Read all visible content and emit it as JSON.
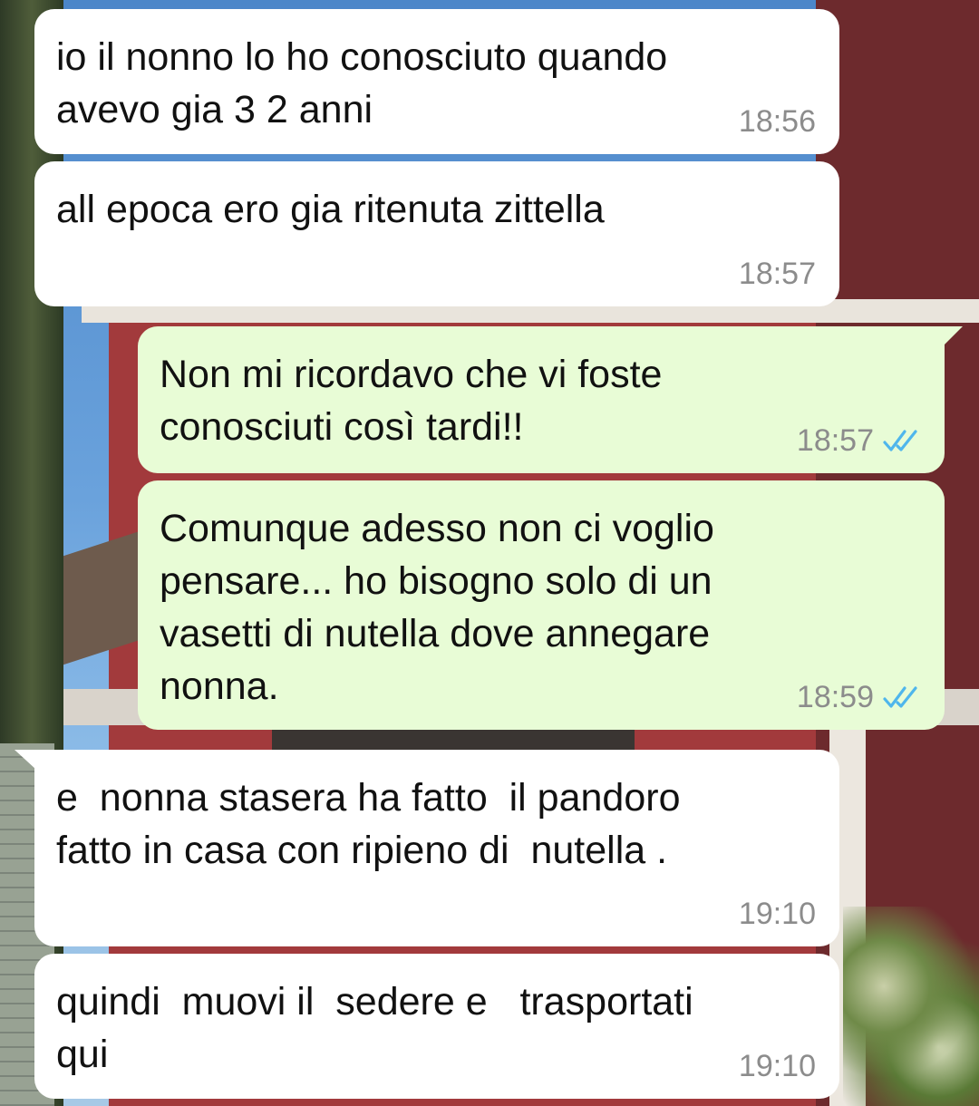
{
  "messages": [
    {
      "direction": "in",
      "text": "io il nonno lo ho conosciuto quando\navevo gia 3 2 anni",
      "time": "18:56"
    },
    {
      "direction": "in",
      "text": "all epoca ero gia ritenuta zittella",
      "time": "18:57"
    },
    {
      "direction": "out",
      "text": "Non mi ricordavo che vi foste\nconosciuti così tardi!!",
      "time": "18:57",
      "status": "read"
    },
    {
      "direction": "out",
      "text": "Comunque adesso non ci voglio\npensare... ho bisogno solo di un\nvasetti di nutella dove annegare\nnonna.",
      "time": "18:59",
      "status": "read"
    },
    {
      "direction": "in",
      "text": "e  nonna stasera ha fatto  il pandoro\nfatto in casa con ripieno di  nutella .",
      "time": "19:10"
    },
    {
      "direction": "in",
      "text": "quindi  muovi il  sedere e   trasportati\nqui",
      "time": "19:10"
    }
  ],
  "icons": {
    "read_receipt": "double-check-icon"
  },
  "colors": {
    "incoming_bubble": "#ffffff",
    "outgoing_bubble": "#e8fcd6",
    "timestamp": "#8c8c8c",
    "read_tick": "#4fb6ec"
  }
}
